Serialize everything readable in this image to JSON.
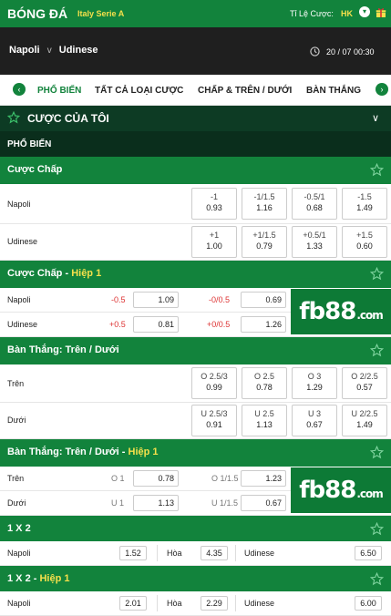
{
  "header": {
    "title": "BÓNG ĐÁ",
    "league": "Italy Serie A",
    "odds_label": "Tỉ Lệ Cược:",
    "odds_value": "HK",
    "chevron": "chevron-down-icon",
    "gift": "gift-icon"
  },
  "match": {
    "home": "Napoli",
    "vs": "v",
    "away": "Udinese",
    "time": "20 / 07  00:30"
  },
  "tabs": [
    "PHỔ BIẾN",
    "TẤT CẢ LOẠI CƯỢC",
    "CHẤP & TRÊN / DƯỚI",
    "BÀN THẮNG"
  ],
  "my_bets": {
    "label": "CƯỢC CỦA TÔI"
  },
  "popular": {
    "label": "PHỔ BIẾN"
  },
  "handicap": {
    "title": "Cược Chấp",
    "rows": [
      {
        "team": "Napoli",
        "cells": [
          [
            "-1",
            "0.93"
          ],
          [
            "-1/1.5",
            "1.16"
          ],
          [
            "-0.5/1",
            "0.68"
          ],
          [
            "-1.5",
            "1.49"
          ]
        ]
      },
      {
        "team": "Udinese",
        "cells": [
          [
            "+1",
            "1.00"
          ],
          [
            "+1/1.5",
            "0.79"
          ],
          [
            "+0.5/1",
            "1.33"
          ],
          [
            "+1.5",
            "0.60"
          ]
        ]
      }
    ]
  },
  "handicap_h1": {
    "title": "Cược Chấp - ",
    "half": "Hiệp 1",
    "rows": [
      {
        "team": "Napoli",
        "h1": "-0.5",
        "o1": "1.09",
        "h2": "-0/0.5",
        "o2": "0.69"
      },
      {
        "team": "Udinese",
        "h1": "+0.5",
        "o1": "0.81",
        "h2": "+0/0.5",
        "o2": "1.26"
      }
    ]
  },
  "ou": {
    "title": "Bàn Thắng: Trên / Dưới",
    "rows": [
      {
        "team": "Trên",
        "cells": [
          [
            "O 2.5/3",
            "0.99"
          ],
          [
            "O 2.5",
            "0.78"
          ],
          [
            "O 3",
            "1.29"
          ],
          [
            "O 2/2.5",
            "0.57"
          ]
        ]
      },
      {
        "team": "Dưới",
        "cells": [
          [
            "U 2.5/3",
            "0.91"
          ],
          [
            "U 2.5",
            "1.13"
          ],
          [
            "U 3",
            "0.67"
          ],
          [
            "U 2/2.5",
            "1.49"
          ]
        ]
      }
    ]
  },
  "ou_h1": {
    "title": "Bàn Thắng: Trên / Dưới - ",
    "half": "Hiệp 1",
    "rows": [
      {
        "team": "Trên",
        "h1": "O 1",
        "o1": "0.78",
        "h2": "O 1/1.5",
        "o2": "1.23"
      },
      {
        "team": "Dưới",
        "h1": "U 1",
        "o1": "1.13",
        "h2": "U 1/1.5",
        "o2": "0.67"
      }
    ]
  },
  "x2": {
    "title": "1 X 2",
    "home": "Napoli",
    "home_odds": "1.52",
    "draw": "Hòa",
    "draw_odds": "4.35",
    "away": "Udinese",
    "away_odds": "6.50"
  },
  "x2_h1": {
    "title": "1 X 2 - ",
    "half": "Hiệp 1",
    "home": "Napoli",
    "home_odds": "2.01",
    "draw": "Hòa",
    "draw_odds": "2.29",
    "away": "Udinese",
    "away_odds": "6.00"
  },
  "brand": {
    "logo_main": "fb88",
    "logo_suffix": ".com",
    "accent": "#12833c",
    "highlight": "#f5e04b"
  }
}
